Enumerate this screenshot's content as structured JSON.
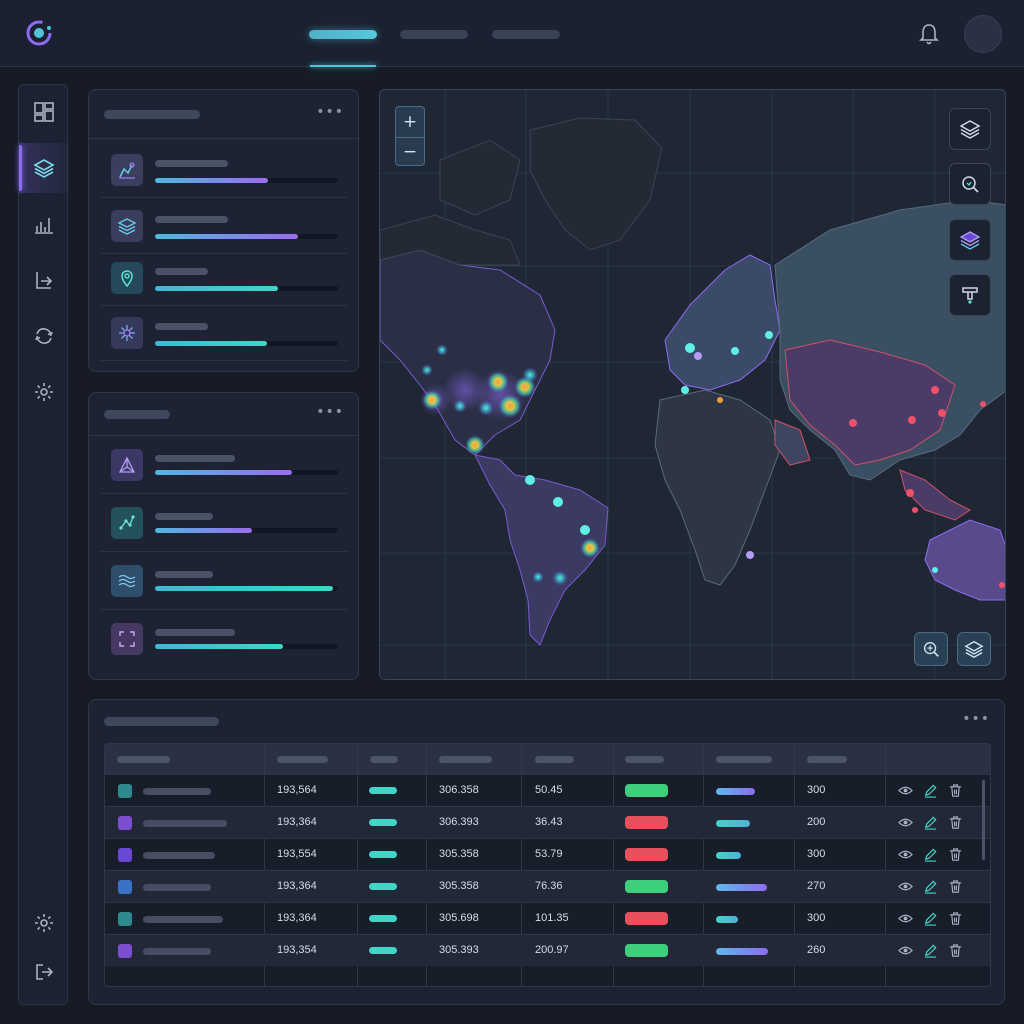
{
  "app": {
    "accent": "#8c6cf0",
    "secondary_accent": "#3fd6c6",
    "nav_tabs": [
      {
        "icon": "nav-tab-active"
      },
      {
        "icon": "nav-tab"
      },
      {
        "icon": "nav-tab"
      }
    ]
  },
  "sidebar": {
    "items": [
      {
        "icon": "dashboard-icon",
        "active": false
      },
      {
        "icon": "layers-icon",
        "active": true
      },
      {
        "icon": "bar-chart-icon",
        "active": false
      },
      {
        "icon": "export-icon",
        "active": false
      },
      {
        "icon": "sync-icon",
        "active": false
      },
      {
        "icon": "gear-icon",
        "active": false
      }
    ],
    "bottom_items": [
      {
        "icon": "gear-icon"
      },
      {
        "icon": "logout-icon"
      }
    ]
  },
  "layer_panel_1": {
    "menu_glyph": "•••",
    "rows": [
      {
        "icon": "map-route-icon",
        "progress": 0.62,
        "color": "#8c6cf0"
      },
      {
        "icon": "layers-icon",
        "progress": 0.78,
        "color": "#8c6cf0"
      },
      {
        "icon": "location-pin-icon",
        "progress": 0.67,
        "color": "#3fd6c6"
      },
      {
        "icon": "sparkle-icon",
        "progress": 0.61,
        "color": "#3fd6c6"
      }
    ]
  },
  "layer_panel_2": {
    "menu_glyph": "•••",
    "rows": [
      {
        "icon": "triangle-network-icon",
        "progress": 0.75,
        "color": "#8c6cf0"
      },
      {
        "icon": "scatter-icon",
        "progress": 0.53,
        "color": "#8c6cf0"
      },
      {
        "icon": "waves-icon",
        "progress": 0.97,
        "color": "#3fd6c6"
      },
      {
        "icon": "frame-icon",
        "progress": 0.7,
        "color": "#3fd6c6"
      }
    ]
  },
  "map": {
    "zoom_in": "+",
    "zoom_out": "−",
    "tools": [
      "layers-icon",
      "zoom-search-icon",
      "layers-stack-icon",
      "filter-icon"
    ],
    "bottom_tools": [
      "zoom-search-icon",
      "layers-icon"
    ]
  },
  "table": {
    "menu_glyph": "•••",
    "rows": [
      {
        "color": "#2f8a90",
        "c2": "193,564",
        "c4": "306.358",
        "c5": "50.45",
        "status": "#3ecf7a",
        "prog": 0.75,
        "prog_color": "purple",
        "c8": "300"
      },
      {
        "color": "#7d4fd0",
        "c2": "193,364",
        "c4": "306.393",
        "c5": "36.43",
        "status": "#e8505b",
        "prog": 0.65,
        "prog_color": "teal",
        "c8": "200"
      },
      {
        "color": "#6a48d6",
        "c2": "193,554",
        "c4": "305.358",
        "c5": "53.79",
        "status": "#e8505b",
        "prog": 0.48,
        "prog_color": "teal",
        "c8": "300"
      },
      {
        "color": "#3a72c8",
        "c2": "193,364",
        "c4": "305.358",
        "c5": "76.36",
        "status": "#3ecf7a",
        "prog": 0.98,
        "prog_color": "purple",
        "c8": "270"
      },
      {
        "color": "#2f8a90",
        "c2": "193,364",
        "c4": "305.698",
        "c5": "101.35",
        "status": "#e8505b",
        "prog": 0.42,
        "prog_color": "teal",
        "c8": "300"
      },
      {
        "color": "#7d4fd0",
        "c2": "193,354",
        "c4": "305.393",
        "c5": "200.97",
        "status": "#3ecf7a",
        "prog": 1.0,
        "prog_color": "purple",
        "c8": "260"
      }
    ]
  }
}
